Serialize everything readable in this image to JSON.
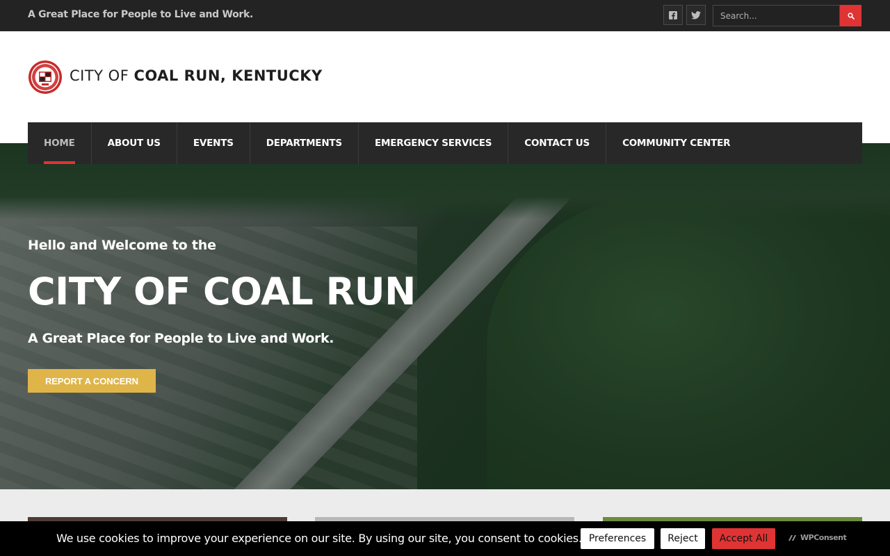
{
  "topbar": {
    "tagline": "A Great Place for People to Live and Work.",
    "social": [
      {
        "icon": "facebook-icon"
      },
      {
        "icon": "twitter-icon"
      }
    ],
    "search": {
      "placeholder": "Search...",
      "value": "",
      "button_icon": "search-icon"
    }
  },
  "header": {
    "logo_icon": "city-seal-logo",
    "site_name_light": "CITY OF",
    "site_name_bold": "COAL RUN, KENTUCKY"
  },
  "nav": {
    "items": [
      {
        "label": "HOME",
        "active": true
      },
      {
        "label": "ABOUT US"
      },
      {
        "label": "EVENTS"
      },
      {
        "label": "DEPARTMENTS"
      },
      {
        "label": "EMERGENCY SERVICES"
      },
      {
        "label": "CONTACT US"
      },
      {
        "label": "COMMUNITY CENTER"
      }
    ]
  },
  "hero": {
    "intro": "Hello and Welcome to the",
    "title": "CITY OF COAL RUN",
    "subtitle": "A Great Place for People to Live and Work.",
    "cta_label": "REPORT A CONCERN"
  },
  "cookie_bar": {
    "message": "We use cookies to improve your experience on our site. By using our site, you consent to cookies.",
    "preferences_label": "Preferences",
    "reject_label": "Reject",
    "accept_label": "Accept All",
    "brand": "WPConsent"
  },
  "colors": {
    "accent_red": "#e03434",
    "cta_gold": "#dfb54a",
    "dark_bar": "#232323",
    "nav_bg": "#282828"
  }
}
